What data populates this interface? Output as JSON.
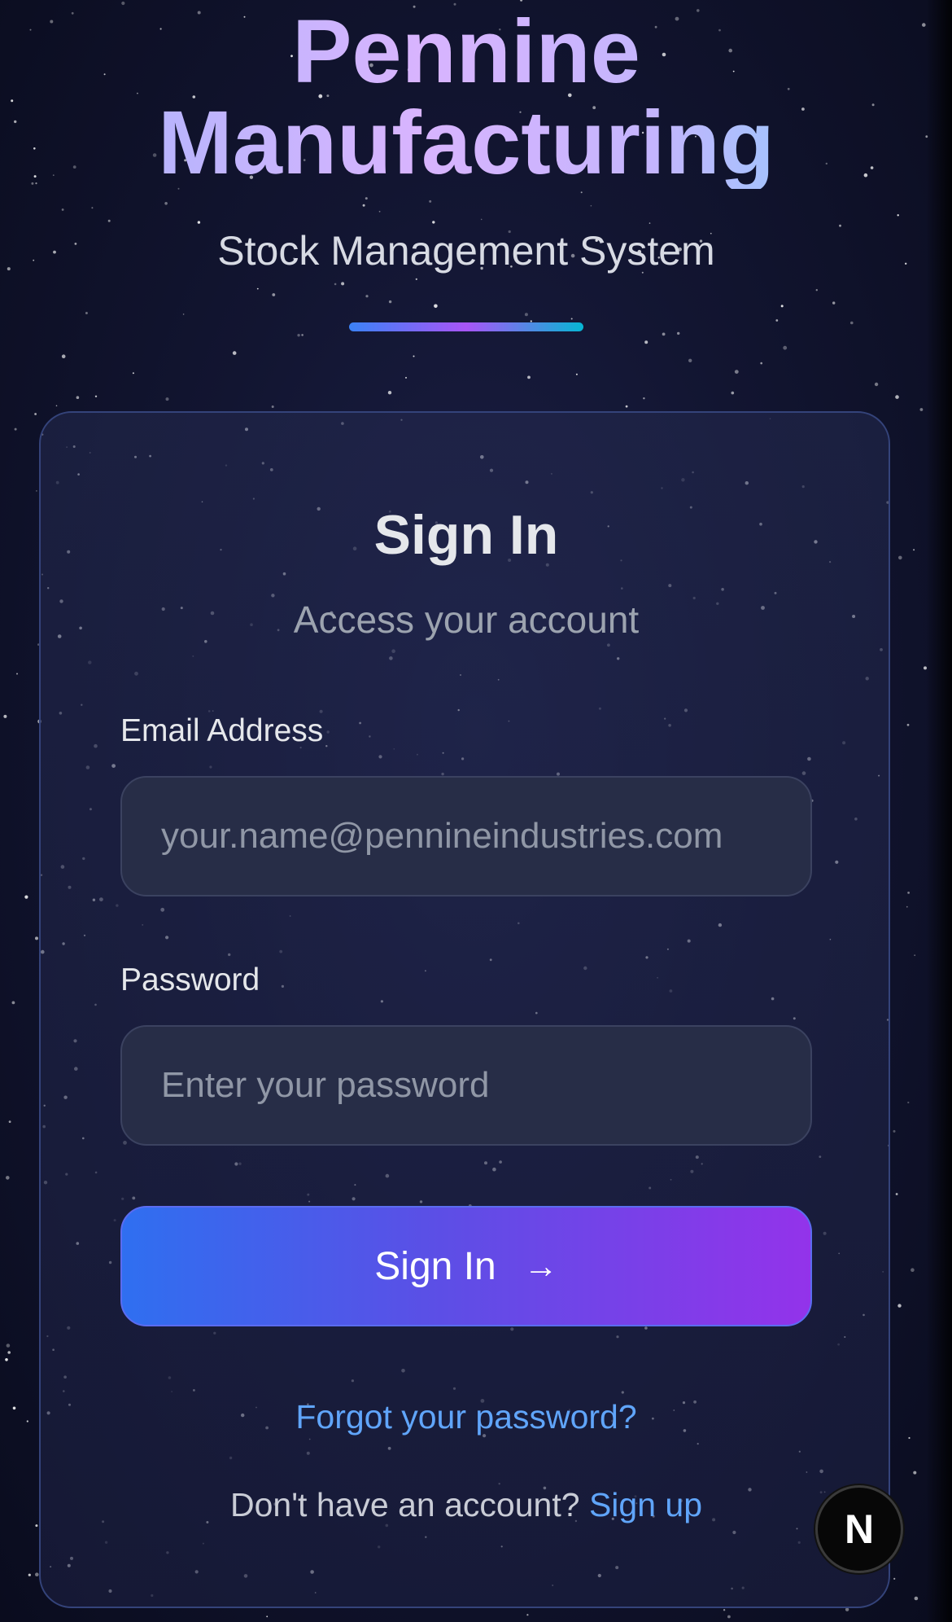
{
  "header": {
    "brand_title": "Pennine Manufacturing",
    "subtitle": "Stock Management System"
  },
  "card": {
    "title": "Sign In",
    "subtitle": "Access your account",
    "email": {
      "label": "Email Address",
      "placeholder": "your.name@pennineindustries.com",
      "value": ""
    },
    "password": {
      "label": "Password",
      "placeholder": "Enter your password",
      "value": ""
    },
    "submit_label": "Sign In",
    "submit_icon": "arrow-right-icon",
    "forgot_link": "Forgot your password?",
    "signup_prompt": "Don't have an account?",
    "signup_link": "Sign up"
  },
  "dev_badge": {
    "letter": "N",
    "icon": "nextjs-icon"
  },
  "colors": {
    "accent_link": "#60a5fa",
    "button_gradient_start": "#2f6ff0",
    "button_gradient_end": "#9333ea",
    "background": "#121531"
  }
}
